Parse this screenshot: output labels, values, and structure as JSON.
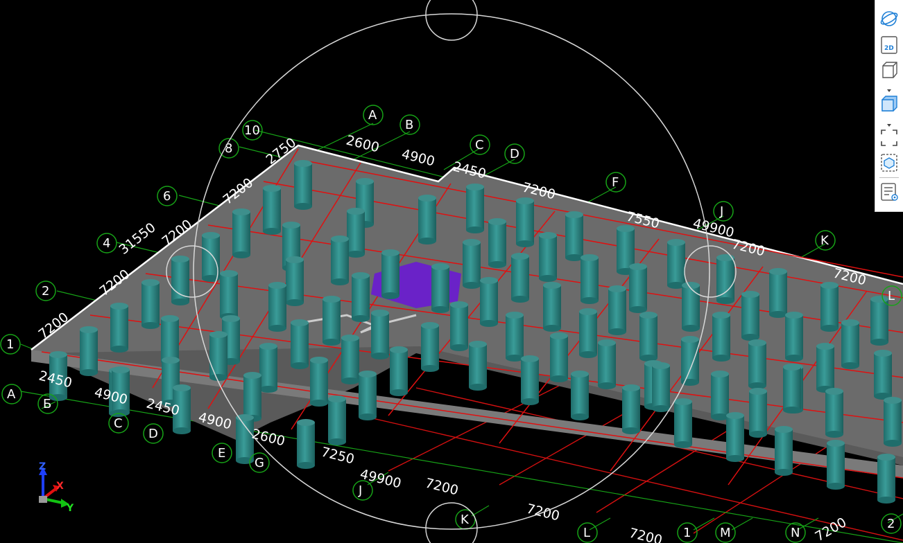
{
  "viewport": {
    "grid_bubbles_top": [
      "A",
      "B",
      "C",
      "D",
      "F",
      "J",
      "K",
      "L"
    ],
    "grid_bubbles_left": [
      "10",
      "8",
      "6",
      "4",
      "2",
      "1"
    ],
    "grid_bubbles_bottom": [
      "A",
      "Б",
      "C",
      "D",
      "E",
      "G",
      "J",
      "K",
      "L",
      "1",
      "M",
      "N",
      "2"
    ],
    "dimensions_top": [
      "2600",
      "4900",
      "2450",
      "7200",
      "7550",
      "49900",
      "7200",
      "7200"
    ],
    "dimensions_left": [
      "2750",
      "7200",
      "31550",
      "7200",
      "7200",
      "7200"
    ],
    "dimensions_bottom": [
      "2450",
      "4900",
      "2450",
      "4900",
      "2600",
      "7250",
      "49900",
      "7200",
      "7200",
      "7200",
      "7200"
    ]
  },
  "axis_triad": {
    "x_label": "X",
    "y_label": "Y",
    "z_label": "Z"
  },
  "toolbar": {
    "orbit_icon": "orbit-icon",
    "view2d_label": "2D",
    "view_cube_icon": "cube-outline-icon",
    "shaded_icon": "cube-shaded-icon",
    "zoom_extents_icon": "zoom-extents-icon",
    "section_box_icon": "section-box-icon",
    "properties_icon": "view-properties-icon"
  },
  "colors": {
    "background": "#000000",
    "slab": "#6b6b6b",
    "column": "#2f8d8a",
    "grid_green": "#1aa31a",
    "grid_red": "#e01010",
    "opening": "#6a22c8",
    "accent_blue": "#1e7fd6"
  }
}
